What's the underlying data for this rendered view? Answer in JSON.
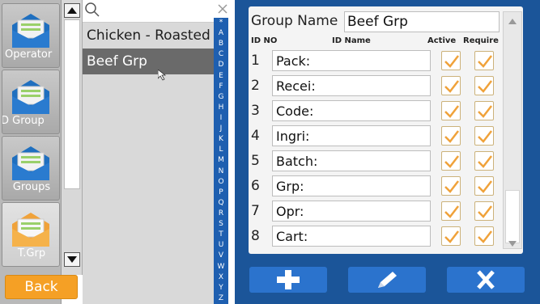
{
  "nav": {
    "items": [
      {
        "label": "Operator",
        "icon": "envelope-icon"
      },
      {
        "label": "D Group",
        "icon": "envelope-icon"
      },
      {
        "label": "Groups",
        "icon": "envelope-icon"
      },
      {
        "label": "T.Grp",
        "icon": "envelope-icon"
      }
    ],
    "back_label": "Back"
  },
  "list": {
    "items": [
      {
        "label": "Chicken - Roasted"
      },
      {
        "label": "Beef Grp"
      }
    ],
    "selected_index": 1
  },
  "alphabet": [
    "*",
    "A",
    "B",
    "C",
    "D",
    "E",
    "F",
    "G",
    "H",
    "I",
    "J",
    "K",
    "L",
    "M",
    "N",
    "O",
    "P",
    "Q",
    "R",
    "S",
    "T",
    "U",
    "V",
    "W",
    "X",
    "Y",
    "Z"
  ],
  "form": {
    "group_name_label": "Group Name",
    "group_name_value": "Beef Grp",
    "headers": {
      "id": "ID NO",
      "name": "ID Name",
      "active": "Active",
      "require": "Require"
    },
    "rows": [
      {
        "id": "1",
        "name": "Pack:",
        "active": true,
        "require": true
      },
      {
        "id": "2",
        "name": "Recei:",
        "active": true,
        "require": true
      },
      {
        "id": "3",
        "name": "Code:",
        "active": true,
        "require": true
      },
      {
        "id": "4",
        "name": "Ingri:",
        "active": true,
        "require": true
      },
      {
        "id": "5",
        "name": "Batch:",
        "active": true,
        "require": true
      },
      {
        "id": "6",
        "name": "Grp:",
        "active": true,
        "require": true
      },
      {
        "id": "7",
        "name": "Opr:",
        "active": true,
        "require": true
      },
      {
        "id": "8",
        "name": "Cart:",
        "active": true,
        "require": true
      }
    ]
  },
  "actions": [
    {
      "name": "add",
      "icon": "plus-icon"
    },
    {
      "name": "edit",
      "icon": "pencil-icon"
    },
    {
      "name": "delete",
      "icon": "x-icon"
    }
  ],
  "colors": {
    "accent_orange": "#f5a025",
    "panel_blue": "#1b5599",
    "alpha_blue": "#1e5fb0",
    "button_blue": "#2b73cd",
    "check_orange": "#f0a23a"
  }
}
